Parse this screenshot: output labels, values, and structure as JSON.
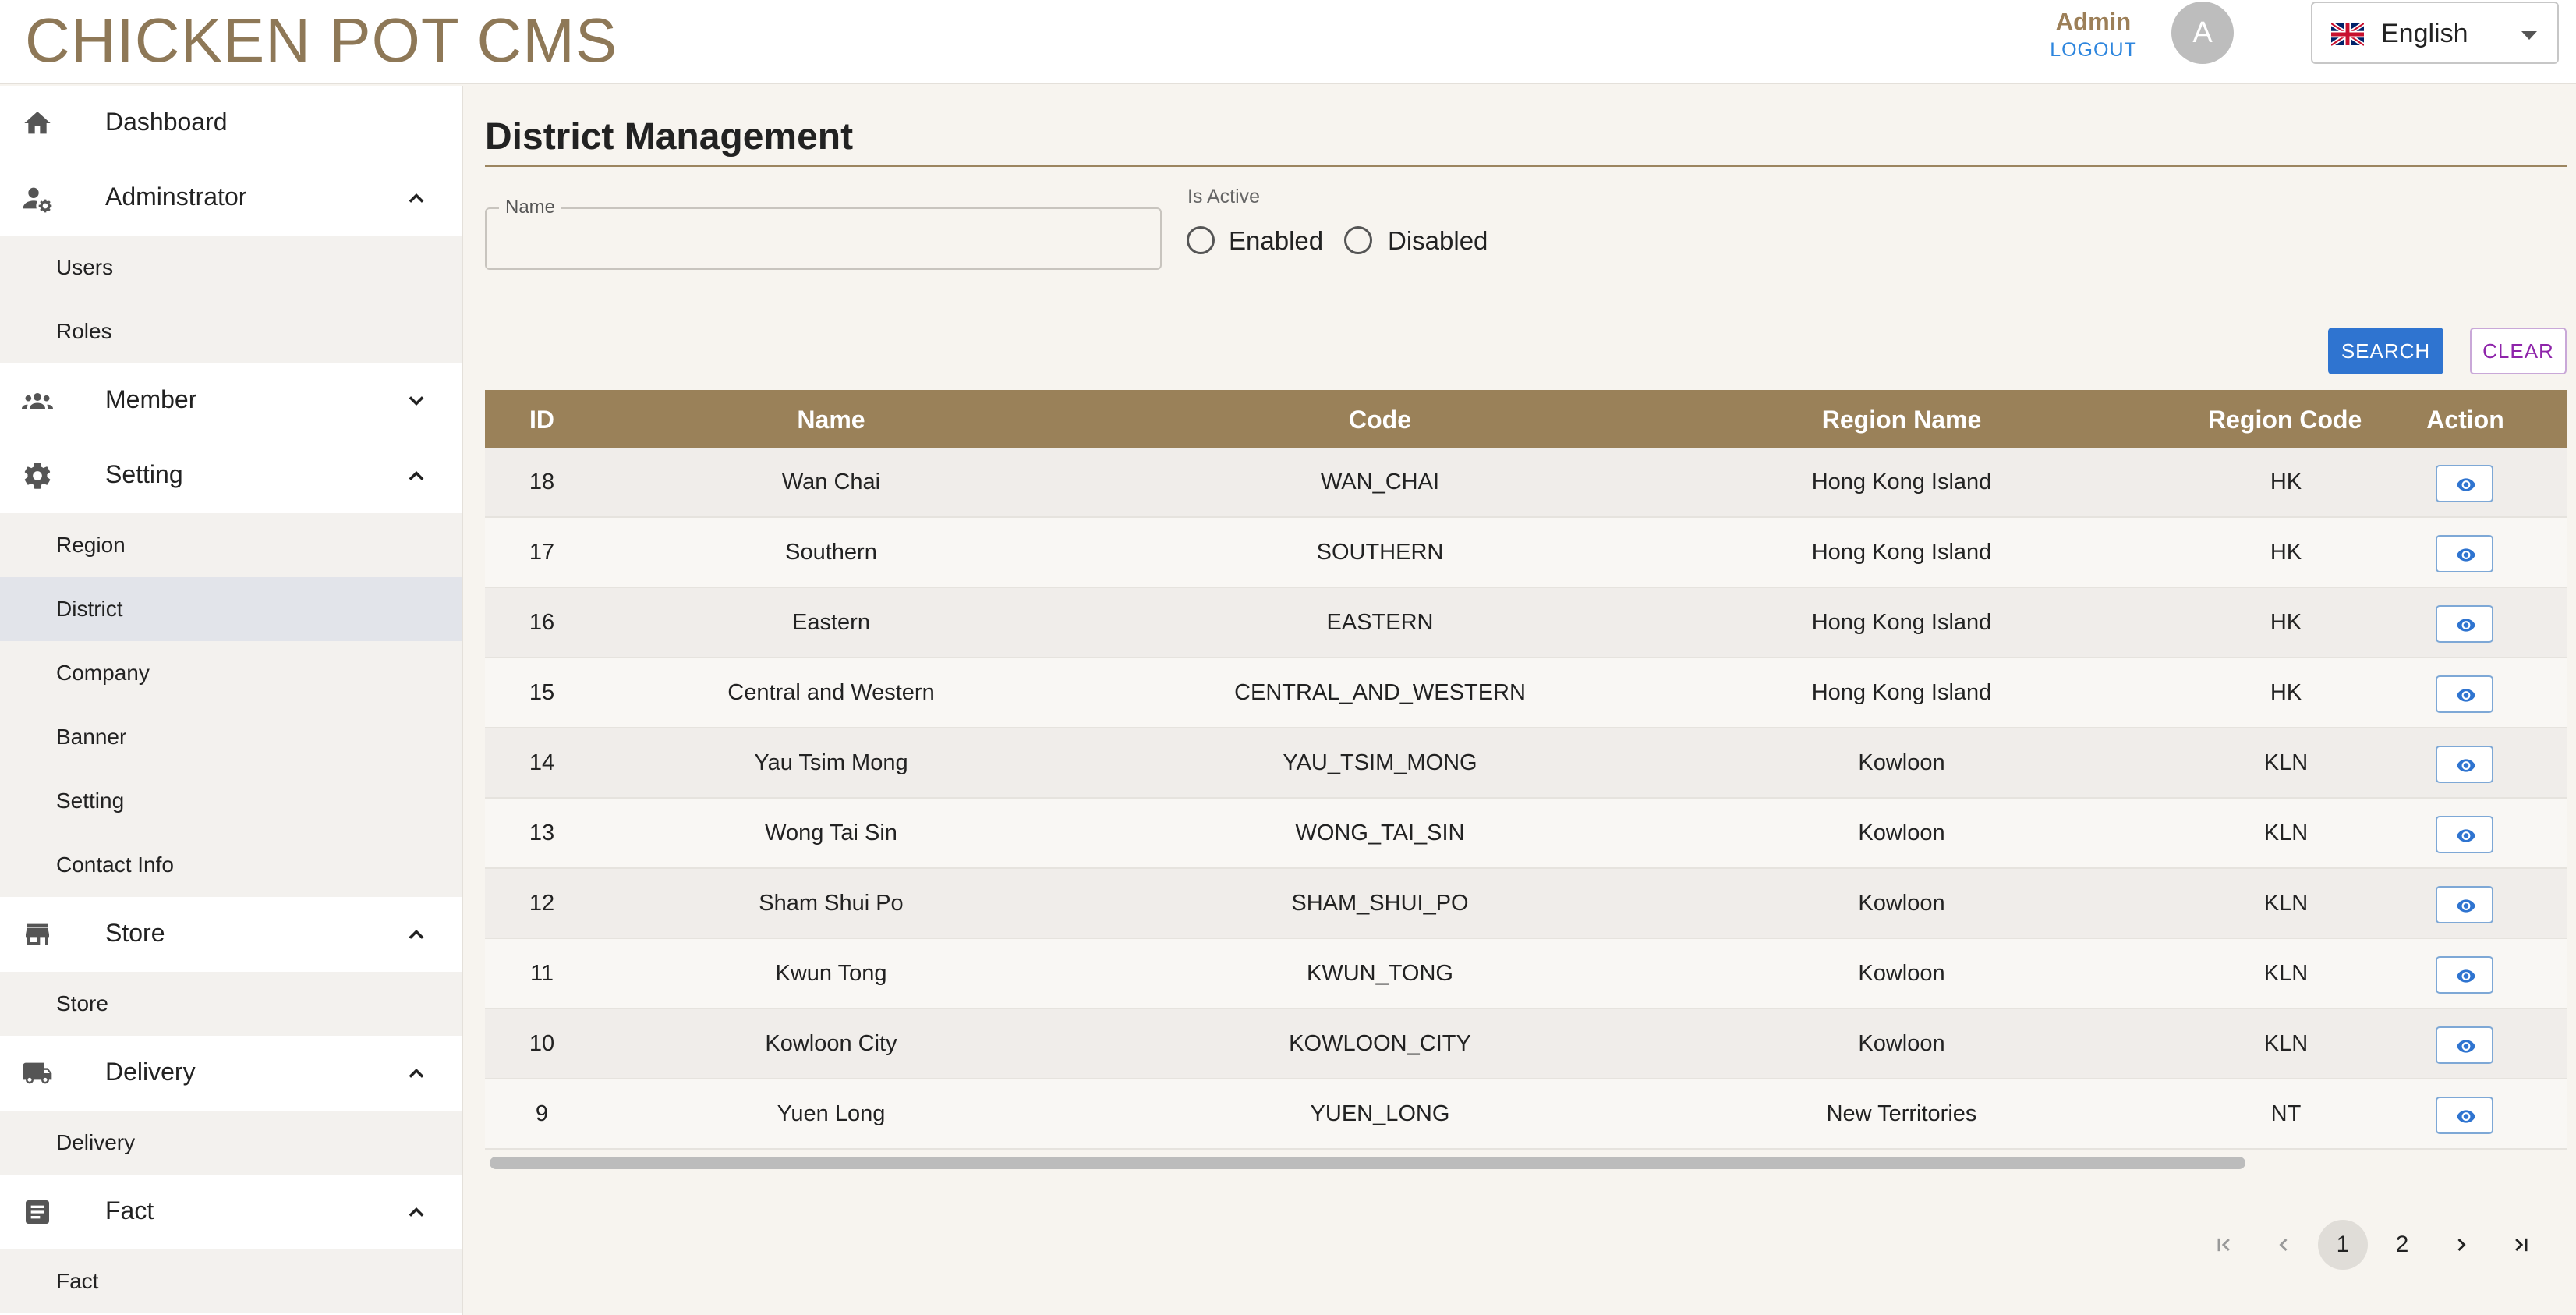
{
  "app": {
    "title": "CHICKEN POT CMS"
  },
  "user": {
    "name": "Admin",
    "logout_label": "LOGOUT",
    "avatar_letter": "A"
  },
  "language": {
    "selected": "English"
  },
  "sidebar": {
    "items": [
      {
        "label": "Dashboard",
        "icon": "home-icon"
      },
      {
        "label": "Adminstrator",
        "icon": "admin-settings-icon",
        "expanded": true,
        "children": [
          "Users",
          "Roles"
        ]
      },
      {
        "label": "Member",
        "icon": "group-icon",
        "expanded": false
      },
      {
        "label": "Setting",
        "icon": "gear-icon",
        "expanded": true,
        "children": [
          "Region",
          "District",
          "Company",
          "Banner",
          "Setting",
          "Contact Info"
        ]
      },
      {
        "label": "Store",
        "icon": "store-icon",
        "expanded": true,
        "children": [
          "Store"
        ]
      },
      {
        "label": "Delivery",
        "icon": "truck-icon",
        "expanded": true,
        "children": [
          "Delivery"
        ]
      },
      {
        "label": "Fact",
        "icon": "document-icon",
        "expanded": true,
        "children": [
          "Fact"
        ]
      }
    ],
    "active": "District"
  },
  "page": {
    "title": "District Management"
  },
  "filters": {
    "name_label": "Name",
    "name_value": "",
    "is_active_label": "Is Active",
    "enabled_label": "Enabled",
    "disabled_label": "Disabled",
    "search_label": "SEARCH",
    "clear_label": "CLEAR"
  },
  "table": {
    "columns": [
      "ID",
      "Name",
      "Code",
      "Region Name",
      "Region Code",
      "Action"
    ],
    "rows": [
      [
        "18",
        "Wan Chai",
        "WAN_CHAI",
        "Hong Kong Island",
        "HK"
      ],
      [
        "17",
        "Southern",
        "SOUTHERN",
        "Hong Kong Island",
        "HK"
      ],
      [
        "16",
        "Eastern",
        "EASTERN",
        "Hong Kong Island",
        "HK"
      ],
      [
        "15",
        "Central and Western",
        "CENTRAL_AND_WESTERN",
        "Hong Kong Island",
        "HK"
      ],
      [
        "14",
        "Yau Tsim Mong",
        "YAU_TSIM_MONG",
        "Kowloon",
        "KLN"
      ],
      [
        "13",
        "Wong Tai Sin",
        "WONG_TAI_SIN",
        "Kowloon",
        "KLN"
      ],
      [
        "12",
        "Sham Shui Po",
        "SHAM_SHUI_PO",
        "Kowloon",
        "KLN"
      ],
      [
        "11",
        "Kwun Tong",
        "KWUN_TONG",
        "Kowloon",
        "KLN"
      ],
      [
        "10",
        "Kowloon City",
        "KOWLOON_CITY",
        "Kowloon",
        "KLN"
      ],
      [
        "9",
        "Yuen Long",
        "YUEN_LONG",
        "New Territories",
        "NT"
      ]
    ],
    "action_icon": "eye-icon"
  },
  "pagination": {
    "pages": [
      "1",
      "2"
    ],
    "current": "1"
  },
  "colors": {
    "brand": "#9a8159",
    "accent_blue": "#2f74d0",
    "clear_purple": "#8e24aa"
  }
}
